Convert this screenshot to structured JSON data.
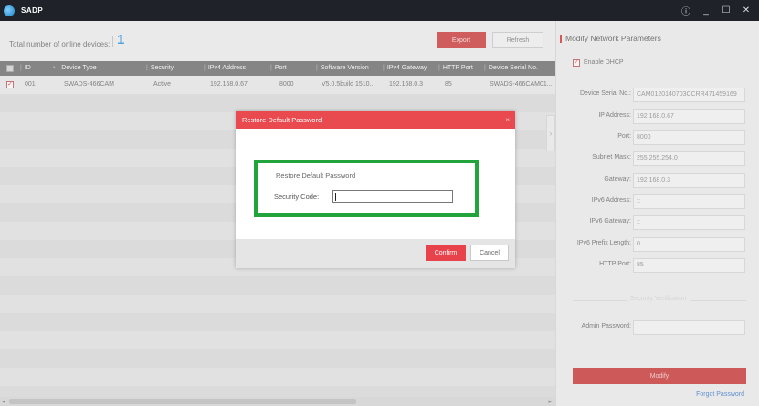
{
  "window": {
    "title": "SADP",
    "controls": {
      "info": "ⓘ",
      "minimize": "_",
      "maximize": "☐",
      "close": "✕"
    }
  },
  "toolbar": {
    "online_label": "Total number of online devices:",
    "online_count": "1",
    "export_label": "Export",
    "refresh_label": "Refresh"
  },
  "table": {
    "columns": [
      "ID",
      "Device Type",
      "Security",
      "IPv4 Address",
      "Port",
      "Software Version",
      "IPv4 Gateway",
      "HTTP Port",
      "Device Serial No."
    ],
    "rows": [
      {
        "checked": "✓",
        "id": "001",
        "device_type": "SWADS-466CAM",
        "security": "Active",
        "ipv4": "192.168.0.67",
        "port": "8000",
        "software": "V5.0.5build 1510...",
        "gateway": "192.168.0.3",
        "http_port": "85",
        "serial": "SWADS-466CAM01..."
      }
    ]
  },
  "scroll": {
    "left_arrow": "◂",
    "right_arrow": "▸"
  },
  "collapse_glyph": "›",
  "panel": {
    "title": "Modify Network Parameters",
    "dhcp_check": "✓",
    "dhcp_label": "Enable DHCP",
    "fields": {
      "serial": {
        "label": "Device Serial No.:",
        "value": "CAM0120140703CCRR471459169"
      },
      "ip": {
        "label": "IP Address:",
        "value": "192.168.0.67"
      },
      "port": {
        "label": "Port:",
        "value": "8000"
      },
      "mask": {
        "label": "Subnet Mask:",
        "value": "255.255.254.0"
      },
      "gateway": {
        "label": "Gateway:",
        "value": "192.168.0.3"
      },
      "ipv6_addr": {
        "label": "IPv6 Address:",
        "value": "::"
      },
      "ipv6_gw": {
        "label": "IPv6 Gateway:",
        "value": "::"
      },
      "ipv6_prefix": {
        "label": "IPv6 Prefix Length:",
        "value": "0"
      },
      "http": {
        "label": "HTTP Port:",
        "value": "85"
      }
    },
    "security_verification": "Security Verification",
    "admin_label": "Admin Password:",
    "modify_label": "Modify",
    "forgot_label": "Forgot Password"
  },
  "dialog": {
    "title": "Restore Default Password",
    "close": "×",
    "section_label": "Restore Default Password",
    "security_code_label": "Security Code:",
    "security_code_value": "",
    "confirm_label": "Confirm",
    "cancel_label": "Cancel"
  },
  "colors": {
    "accent_red": "#e84a50",
    "highlight_green": "#22a33b",
    "count_blue": "#2a8fd8",
    "link_blue": "#3b79c7"
  }
}
